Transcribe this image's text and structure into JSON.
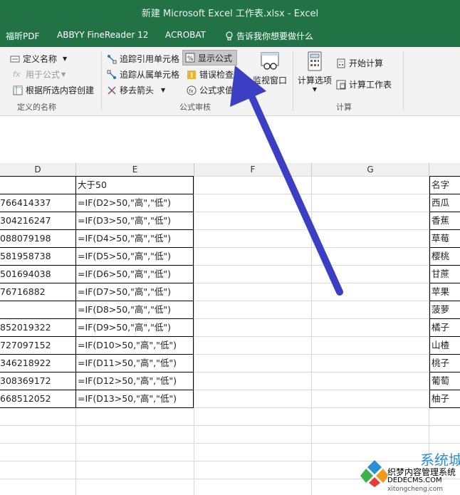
{
  "window": {
    "title": "新建 Microsoft Excel 工作表.xlsx  -  Excel"
  },
  "tabs": [
    {
      "label": "福昕PDF"
    },
    {
      "label": "ABBYY FineReader 12"
    },
    {
      "label": "ACROBAT"
    },
    {
      "label": "告诉我你想要做什么"
    }
  ],
  "ribbon": {
    "defined_names": {
      "define_name": "定义名称",
      "use_in_formula": "用于公式",
      "create_from_selection": "根据所选内容创建",
      "group_label": "定义的名称"
    },
    "formula_auditing": {
      "trace_precedents": "追踪引用单元格",
      "trace_dependents": "追踪从属单元格",
      "remove_arrows": "移去箭头",
      "show_formulas": "显示公式",
      "error_checking": "错误检查",
      "evaluate_formula": "公式求值",
      "group_label": "公式审核"
    },
    "watch_window": "监视窗口",
    "calculation": {
      "calc_options": "计算选项",
      "calc_now": "开始计算",
      "calc_sheet": "计算工作表",
      "group_label": "计算"
    }
  },
  "columns": [
    "D",
    "E",
    "F",
    "G"
  ],
  "rows": [
    {
      "d": "",
      "e": "大于50",
      "h": "名字"
    },
    {
      "d": "766414337",
      "e": "=IF(D2>50,\"高\",\"低\")",
      "h": "西瓜"
    },
    {
      "d": "304216247",
      "e": "=IF(D3>50,\"高\",\"低\")",
      "h": "香蕉"
    },
    {
      "d": "088079198",
      "e": "=IF(D4>50,\"高\",\"低\")",
      "h": "草莓"
    },
    {
      "d": "581958738",
      "e": "=IF(D5>50,\"高\",\"低\")",
      "h": "樱桃"
    },
    {
      "d": "501694038",
      "e": "=IF(D6>50,\"高\",\"低\")",
      "h": "甘蔗"
    },
    {
      "d": "76716882",
      "e": "=IF(D7>50,\"高\",\"低\")",
      "h": "苹果"
    },
    {
      "d": "",
      "e": "=IF(D8>50,\"高\",\"低\")",
      "h": "菠萝"
    },
    {
      "d": "852019322",
      "e": "=IF(D9>50,\"高\",\"低\")",
      "h": "橘子"
    },
    {
      "d": "727097152",
      "e": "=IF(D10>50,\"高\",\"低\")",
      "h": "山楂"
    },
    {
      "d": "346218922",
      "e": "=IF(D11>50,\"高\",\"低\")",
      "h": "桃子"
    },
    {
      "d": "308369172",
      "e": "=IF(D12>50,\"高\",\"低\")",
      "h": "葡萄"
    },
    {
      "d": "668512052",
      "e": "=IF(D13>50,\"高\",\"低\")",
      "h": "柚子"
    }
  ],
  "watermark": {
    "logo_text": "系统城",
    "line1": "织梦内容管理系统",
    "line2": "DEDECMS.COM",
    "line3": "xitongcheng.com"
  },
  "colors": {
    "excel_green": "#217346",
    "arrow": "#3b3fc4",
    "ribbon_bg": "#f3f3f3"
  },
  "icons": {
    "search": "lightbulb-icon",
    "show_formulas": "show-formulas-icon",
    "error_check": "warning-icon",
    "evaluate": "fx-icon",
    "watch_window": "watch-window-icon",
    "calc_options": "calculator-icon"
  }
}
